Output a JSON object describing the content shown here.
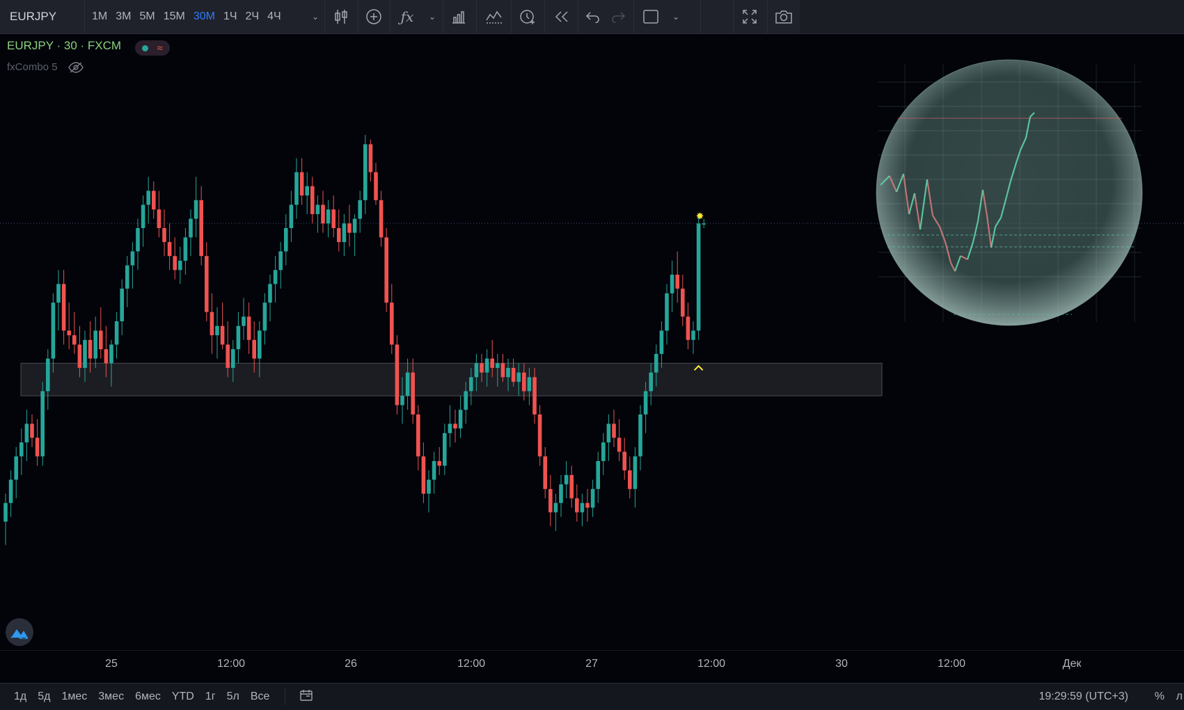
{
  "toolbar": {
    "symbol": "EURJPY",
    "intervals": [
      "1М",
      "3М",
      "5М",
      "15М",
      "30М",
      "1Ч",
      "2Ч",
      "4Ч"
    ],
    "active_interval": "30М"
  },
  "legend": {
    "title": "EURJPY · 30 · FXCM",
    "indicator": "fxCombo 5"
  },
  "bottombar": {
    "ranges": [
      "1д",
      "5д",
      "1мес",
      "3мес",
      "6мес",
      "YTD",
      "1г",
      "5л",
      "Все"
    ],
    "clock": "19:29:59 (UTC+3)",
    "percent": "%",
    "log": "л"
  },
  "colors": {
    "up": "#26a69a",
    "down": "#ef5350",
    "background": "#02040a",
    "zone": "#2a2b30",
    "marker": "#ffeb3b"
  },
  "chart_data": {
    "type": "candlestick",
    "x_tick_labels": [
      "25",
      "12:00",
      "26",
      "12:00",
      "27",
      "12:00",
      "30",
      "12:00",
      "Дек"
    ],
    "price_zone": {
      "low": 44,
      "high": 51
    },
    "current_price_line": 81,
    "candles": [
      {
        "o": 17,
        "h": 23,
        "l": 12,
        "c": 21
      },
      {
        "o": 21,
        "h": 28,
        "l": 18,
        "c": 26
      },
      {
        "o": 26,
        "h": 33,
        "l": 22,
        "c": 31
      },
      {
        "o": 31,
        "h": 37,
        "l": 27,
        "c": 34
      },
      {
        "o": 34,
        "h": 41,
        "l": 30,
        "c": 38
      },
      {
        "o": 38,
        "h": 40,
        "l": 33,
        "c": 35
      },
      {
        "o": 35,
        "h": 39,
        "l": 29,
        "c": 31
      },
      {
        "o": 31,
        "h": 47,
        "l": 29,
        "c": 45
      },
      {
        "o": 45,
        "h": 54,
        "l": 41,
        "c": 52
      },
      {
        "o": 52,
        "h": 66,
        "l": 49,
        "c": 64
      },
      {
        "o": 64,
        "h": 71,
        "l": 58,
        "c": 68
      },
      {
        "o": 68,
        "h": 71,
        "l": 55,
        "c": 58
      },
      {
        "o": 58,
        "h": 64,
        "l": 54,
        "c": 57
      },
      {
        "o": 57,
        "h": 62,
        "l": 53,
        "c": 55
      },
      {
        "o": 55,
        "h": 59,
        "l": 48,
        "c": 50
      },
      {
        "o": 50,
        "h": 58,
        "l": 47,
        "c": 56
      },
      {
        "o": 56,
        "h": 60,
        "l": 49,
        "c": 52
      },
      {
        "o": 52,
        "h": 61,
        "l": 50,
        "c": 58
      },
      {
        "o": 58,
        "h": 63,
        "l": 52,
        "c": 54
      },
      {
        "o": 54,
        "h": 59,
        "l": 48,
        "c": 51
      },
      {
        "o": 51,
        "h": 56,
        "l": 46,
        "c": 55
      },
      {
        "o": 55,
        "h": 62,
        "l": 52,
        "c": 60
      },
      {
        "o": 60,
        "h": 69,
        "l": 57,
        "c": 67
      },
      {
        "o": 67,
        "h": 74,
        "l": 63,
        "c": 72
      },
      {
        "o": 72,
        "h": 77,
        "l": 67,
        "c": 75
      },
      {
        "o": 75,
        "h": 82,
        "l": 71,
        "c": 80
      },
      {
        "o": 80,
        "h": 87,
        "l": 76,
        "c": 85
      },
      {
        "o": 85,
        "h": 91,
        "l": 81,
        "c": 88
      },
      {
        "o": 88,
        "h": 90,
        "l": 82,
        "c": 84
      },
      {
        "o": 84,
        "h": 88,
        "l": 78,
        "c": 80
      },
      {
        "o": 80,
        "h": 84,
        "l": 74,
        "c": 77
      },
      {
        "o": 77,
        "h": 81,
        "l": 71,
        "c": 74
      },
      {
        "o": 74,
        "h": 78,
        "l": 69,
        "c": 71
      },
      {
        "o": 71,
        "h": 76,
        "l": 68,
        "c": 73
      },
      {
        "o": 73,
        "h": 80,
        "l": 70,
        "c": 78
      },
      {
        "o": 78,
        "h": 84,
        "l": 74,
        "c": 82
      },
      {
        "o": 82,
        "h": 91,
        "l": 78,
        "c": 86
      },
      {
        "o": 86,
        "h": 89,
        "l": 72,
        "c": 74
      },
      {
        "o": 74,
        "h": 77,
        "l": 60,
        "c": 62
      },
      {
        "o": 62,
        "h": 66,
        "l": 53,
        "c": 57
      },
      {
        "o": 57,
        "h": 63,
        "l": 52,
        "c": 59
      },
      {
        "o": 59,
        "h": 64,
        "l": 54,
        "c": 55
      },
      {
        "o": 55,
        "h": 60,
        "l": 48,
        "c": 50
      },
      {
        "o": 50,
        "h": 56,
        "l": 47,
        "c": 54
      },
      {
        "o": 54,
        "h": 62,
        "l": 51,
        "c": 59
      },
      {
        "o": 59,
        "h": 65,
        "l": 56,
        "c": 61
      },
      {
        "o": 61,
        "h": 64,
        "l": 53,
        "c": 56
      },
      {
        "o": 56,
        "h": 60,
        "l": 49,
        "c": 52
      },
      {
        "o": 52,
        "h": 60,
        "l": 48,
        "c": 58
      },
      {
        "o": 58,
        "h": 66,
        "l": 55,
        "c": 64
      },
      {
        "o": 64,
        "h": 70,
        "l": 60,
        "c": 68
      },
      {
        "o": 68,
        "h": 74,
        "l": 64,
        "c": 71
      },
      {
        "o": 71,
        "h": 77,
        "l": 67,
        "c": 75
      },
      {
        "o": 75,
        "h": 83,
        "l": 72,
        "c": 80
      },
      {
        "o": 80,
        "h": 88,
        "l": 77,
        "c": 85
      },
      {
        "o": 85,
        "h": 95,
        "l": 82,
        "c": 92
      },
      {
        "o": 92,
        "h": 95,
        "l": 85,
        "c": 87
      },
      {
        "o": 87,
        "h": 92,
        "l": 83,
        "c": 89
      },
      {
        "o": 89,
        "h": 91,
        "l": 81,
        "c": 83
      },
      {
        "o": 83,
        "h": 87,
        "l": 79,
        "c": 85
      },
      {
        "o": 85,
        "h": 88,
        "l": 79,
        "c": 81
      },
      {
        "o": 81,
        "h": 86,
        "l": 78,
        "c": 84
      },
      {
        "o": 84,
        "h": 87,
        "l": 78,
        "c": 80
      },
      {
        "o": 80,
        "h": 84,
        "l": 75,
        "c": 77
      },
      {
        "o": 77,
        "h": 83,
        "l": 74,
        "c": 81
      },
      {
        "o": 81,
        "h": 85,
        "l": 76,
        "c": 79
      },
      {
        "o": 79,
        "h": 83,
        "l": 74,
        "c": 82
      },
      {
        "o": 82,
        "h": 88,
        "l": 79,
        "c": 86
      },
      {
        "o": 86,
        "h": 100,
        "l": 83,
        "c": 98
      },
      {
        "o": 98,
        "h": 99,
        "l": 90,
        "c": 92
      },
      {
        "o": 92,
        "h": 94,
        "l": 85,
        "c": 86
      },
      {
        "o": 86,
        "h": 88,
        "l": 76,
        "c": 78
      },
      {
        "o": 78,
        "h": 80,
        "l": 62,
        "c": 64
      },
      {
        "o": 64,
        "h": 68,
        "l": 53,
        "c": 55
      },
      {
        "o": 55,
        "h": 57,
        "l": 40,
        "c": 42
      },
      {
        "o": 42,
        "h": 48,
        "l": 38,
        "c": 44
      },
      {
        "o": 44,
        "h": 52,
        "l": 41,
        "c": 49
      },
      {
        "o": 49,
        "h": 52,
        "l": 38,
        "c": 40
      },
      {
        "o": 40,
        "h": 42,
        "l": 28,
        "c": 31
      },
      {
        "o": 31,
        "h": 34,
        "l": 21,
        "c": 23
      },
      {
        "o": 23,
        "h": 28,
        "l": 19,
        "c": 26
      },
      {
        "o": 26,
        "h": 32,
        "l": 23,
        "c": 30
      },
      {
        "o": 30,
        "h": 33,
        "l": 27,
        "c": 29
      },
      {
        "o": 29,
        "h": 38,
        "l": 27,
        "c": 36
      },
      {
        "o": 36,
        "h": 42,
        "l": 33,
        "c": 38
      },
      {
        "o": 38,
        "h": 41,
        "l": 34,
        "c": 37
      },
      {
        "o": 37,
        "h": 44,
        "l": 35,
        "c": 41
      },
      {
        "o": 41,
        "h": 47,
        "l": 38,
        "c": 45
      },
      {
        "o": 45,
        "h": 50,
        "l": 42,
        "c": 48
      },
      {
        "o": 48,
        "h": 53,
        "l": 45,
        "c": 51
      },
      {
        "o": 51,
        "h": 53,
        "l": 47,
        "c": 49
      },
      {
        "o": 49,
        "h": 54,
        "l": 46,
        "c": 52
      },
      {
        "o": 52,
        "h": 56,
        "l": 48,
        "c": 50
      },
      {
        "o": 50,
        "h": 53,
        "l": 46,
        "c": 51
      },
      {
        "o": 51,
        "h": 53,
        "l": 47,
        "c": 48
      },
      {
        "o": 48,
        "h": 52,
        "l": 45,
        "c": 50
      },
      {
        "o": 50,
        "h": 52,
        "l": 46,
        "c": 47
      },
      {
        "o": 47,
        "h": 51,
        "l": 44,
        "c": 49
      },
      {
        "o": 49,
        "h": 51,
        "l": 43,
        "c": 45
      },
      {
        "o": 45,
        "h": 50,
        "l": 42,
        "c": 48
      },
      {
        "o": 48,
        "h": 50,
        "l": 38,
        "c": 40
      },
      {
        "o": 40,
        "h": 42,
        "l": 29,
        "c": 31
      },
      {
        "o": 31,
        "h": 33,
        "l": 22,
        "c": 24
      },
      {
        "o": 24,
        "h": 27,
        "l": 16,
        "c": 19
      },
      {
        "o": 19,
        "h": 23,
        "l": 15,
        "c": 21
      },
      {
        "o": 21,
        "h": 27,
        "l": 18,
        "c": 25
      },
      {
        "o": 25,
        "h": 30,
        "l": 22,
        "c": 27
      },
      {
        "o": 27,
        "h": 29,
        "l": 20,
        "c": 22
      },
      {
        "o": 22,
        "h": 25,
        "l": 17,
        "c": 19
      },
      {
        "o": 19,
        "h": 23,
        "l": 16,
        "c": 21
      },
      {
        "o": 21,
        "h": 24,
        "l": 17,
        "c": 20
      },
      {
        "o": 20,
        "h": 26,
        "l": 18,
        "c": 24
      },
      {
        "o": 24,
        "h": 32,
        "l": 21,
        "c": 30
      },
      {
        "o": 30,
        "h": 36,
        "l": 27,
        "c": 34
      },
      {
        "o": 34,
        "h": 40,
        "l": 30,
        "c": 38
      },
      {
        "o": 38,
        "h": 41,
        "l": 33,
        "c": 35
      },
      {
        "o": 35,
        "h": 39,
        "l": 30,
        "c": 32
      },
      {
        "o": 32,
        "h": 35,
        "l": 26,
        "c": 28
      },
      {
        "o": 28,
        "h": 31,
        "l": 22,
        "c": 24
      },
      {
        "o": 24,
        "h": 33,
        "l": 20,
        "c": 31
      },
      {
        "o": 31,
        "h": 42,
        "l": 28,
        "c": 40
      },
      {
        "o": 40,
        "h": 47,
        "l": 36,
        "c": 45
      },
      {
        "o": 45,
        "h": 51,
        "l": 42,
        "c": 49
      },
      {
        "o": 49,
        "h": 55,
        "l": 46,
        "c": 53
      },
      {
        "o": 53,
        "h": 60,
        "l": 50,
        "c": 58
      },
      {
        "o": 58,
        "h": 68,
        "l": 55,
        "c": 66
      },
      {
        "o": 66,
        "h": 73,
        "l": 62,
        "c": 70
      },
      {
        "o": 70,
        "h": 75,
        "l": 64,
        "c": 67
      },
      {
        "o": 67,
        "h": 70,
        "l": 59,
        "c": 61
      },
      {
        "o": 61,
        "h": 64,
        "l": 54,
        "c": 56
      },
      {
        "o": 56,
        "h": 60,
        "l": 53,
        "c": 58
      },
      {
        "o": 58,
        "h": 83,
        "l": 56,
        "c": 81
      },
      {
        "o": 81,
        "h": 82,
        "l": 80,
        "c": 81
      }
    ]
  }
}
